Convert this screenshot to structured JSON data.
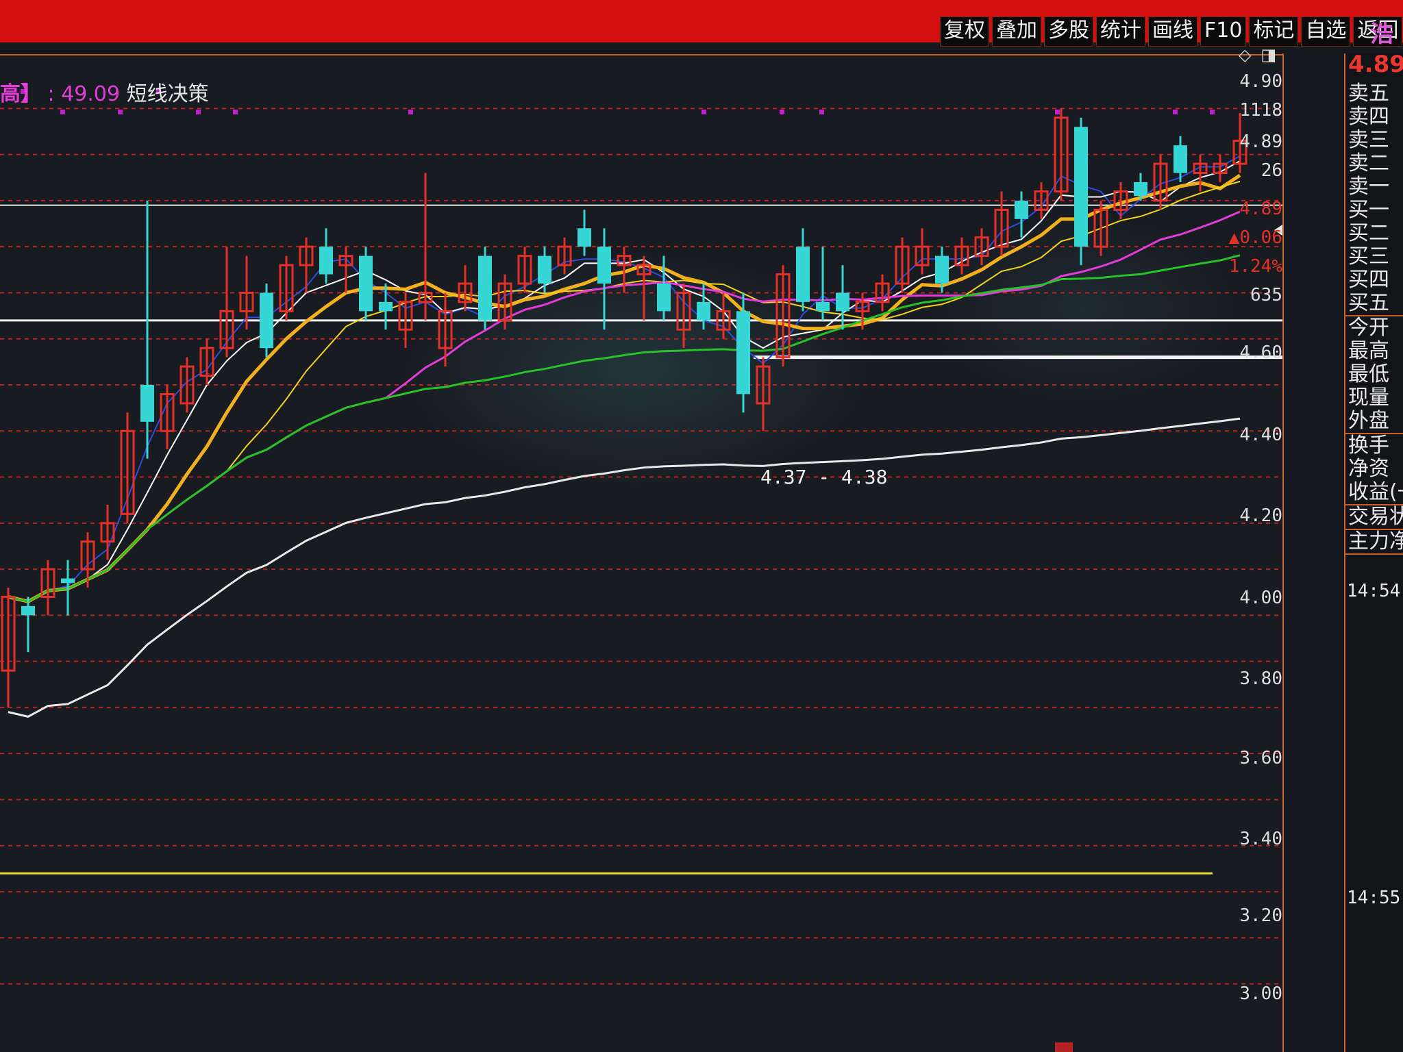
{
  "toolbar": {
    "buttons": [
      "复权",
      "叠加",
      "多股",
      "统计",
      "画线",
      "F10",
      "标记",
      "自选",
      "返回"
    ]
  },
  "stock_name": "浩",
  "indicator": {
    "name_part": "高】",
    "value": ": 49.09",
    "label": "短线决策"
  },
  "price_axis": [
    "4.90",
    "4.89",
    "4.60",
    "4.40",
    "4.20",
    "4.00",
    "3.80",
    "3.60",
    "3.40",
    "3.20",
    "3.00"
  ],
  "quote_side": {
    "ask_vol": "1118",
    "ask2_vol": "26",
    "last_price": "4.89",
    "change": "▲0.06",
    "change_pct": "1.24%",
    "bid_vol": "635"
  },
  "annotation": "4.37 - 4.38",
  "right_panel": {
    "price": "4.89",
    "order_book": [
      "卖五",
      "卖四",
      "卖三",
      "卖二",
      "卖一",
      "买一",
      "买二",
      "买三",
      "买四",
      "买五"
    ],
    "stats": [
      "今开",
      "最高",
      "最低",
      "现量",
      "外盘"
    ],
    "stats2": [
      "换手",
      "净资",
      "收益(一"
    ],
    "extra": [
      "交易状",
      "主力净"
    ],
    "time1": "14:54",
    "time2": "14:55"
  },
  "colors": {
    "up": "#e5302a",
    "down": "#34d6d6",
    "ma5": "#ffffff",
    "ma10": "#f2b01e",
    "ma20": "#e23dd8",
    "ma60": "#27c227",
    "ma120": "#e8e8e8",
    "flat": "#e8e030",
    "grid": "#b82424"
  },
  "chart_data": {
    "type": "candlestick",
    "ylim": [
      2.98,
      4.96
    ],
    "annotation_range": "4.37 - 4.38",
    "candles": [
      {
        "o": 3.68,
        "h": 3.86,
        "l": 3.6,
        "c": 3.84,
        "up": true
      },
      {
        "o": 3.8,
        "h": 3.84,
        "l": 3.72,
        "c": 3.82,
        "up": false
      },
      {
        "o": 3.84,
        "h": 3.92,
        "l": 3.8,
        "c": 3.9,
        "up": true
      },
      {
        "o": 3.88,
        "h": 3.92,
        "l": 3.8,
        "c": 3.87,
        "up": false
      },
      {
        "o": 3.9,
        "h": 3.98,
        "l": 3.86,
        "c": 3.96,
        "up": true
      },
      {
        "o": 3.96,
        "h": 4.04,
        "l": 3.92,
        "c": 4.0,
        "up": true
      },
      {
        "o": 4.02,
        "h": 4.24,
        "l": 4.0,
        "c": 4.2,
        "up": true
      },
      {
        "o": 4.22,
        "h": 4.7,
        "l": 4.14,
        "c": 4.3,
        "up": false
      },
      {
        "o": 4.2,
        "h": 4.3,
        "l": 4.16,
        "c": 4.28,
        "up": true
      },
      {
        "o": 4.26,
        "h": 4.36,
        "l": 4.24,
        "c": 4.34,
        "up": true
      },
      {
        "o": 4.32,
        "h": 4.4,
        "l": 4.3,
        "c": 4.38,
        "up": true
      },
      {
        "o": 4.38,
        "h": 4.6,
        "l": 4.36,
        "c": 4.46,
        "up": true
      },
      {
        "o": 4.46,
        "h": 4.58,
        "l": 4.42,
        "c": 4.5,
        "up": true
      },
      {
        "o": 4.5,
        "h": 4.52,
        "l": 4.36,
        "c": 4.38,
        "up": false
      },
      {
        "o": 4.46,
        "h": 4.58,
        "l": 4.44,
        "c": 4.56,
        "up": true
      },
      {
        "o": 4.56,
        "h": 4.62,
        "l": 4.5,
        "c": 4.6,
        "up": true
      },
      {
        "o": 4.6,
        "h": 4.64,
        "l": 4.52,
        "c": 4.54,
        "up": false
      },
      {
        "o": 4.56,
        "h": 4.6,
        "l": 4.5,
        "c": 4.58,
        "up": true
      },
      {
        "o": 4.58,
        "h": 4.6,
        "l": 4.44,
        "c": 4.46,
        "up": false
      },
      {
        "o": 4.48,
        "h": 4.52,
        "l": 4.42,
        "c": 4.46,
        "up": false
      },
      {
        "o": 4.42,
        "h": 4.5,
        "l": 4.38,
        "c": 4.48,
        "up": true
      },
      {
        "o": 4.48,
        "h": 4.76,
        "l": 4.44,
        "c": 4.5,
        "up": true
      },
      {
        "o": 4.46,
        "h": 4.5,
        "l": 4.34,
        "c": 4.38,
        "up": true
      },
      {
        "o": 4.48,
        "h": 4.56,
        "l": 4.46,
        "c": 4.52,
        "up": true
      },
      {
        "o": 4.58,
        "h": 4.6,
        "l": 4.42,
        "c": 4.44,
        "up": false
      },
      {
        "o": 4.44,
        "h": 4.54,
        "l": 4.42,
        "c": 4.52,
        "up": true
      },
      {
        "o": 4.52,
        "h": 4.6,
        "l": 4.5,
        "c": 4.58,
        "up": true
      },
      {
        "o": 4.58,
        "h": 4.6,
        "l": 4.5,
        "c": 4.52,
        "up": false
      },
      {
        "o": 4.56,
        "h": 4.62,
        "l": 4.54,
        "c": 4.6,
        "up": true
      },
      {
        "o": 4.64,
        "h": 4.68,
        "l": 4.58,
        "c": 4.6,
        "up": false
      },
      {
        "o": 4.6,
        "h": 4.64,
        "l": 4.42,
        "c": 4.52,
        "up": false
      },
      {
        "o": 4.56,
        "h": 4.6,
        "l": 4.5,
        "c": 4.58,
        "up": true
      },
      {
        "o": 4.54,
        "h": 4.58,
        "l": 4.44,
        "c": 4.56,
        "up": true
      },
      {
        "o": 4.52,
        "h": 4.58,
        "l": 4.44,
        "c": 4.46,
        "up": false
      },
      {
        "o": 4.5,
        "h": 4.52,
        "l": 4.38,
        "c": 4.42,
        "up": true
      },
      {
        "o": 4.48,
        "h": 4.52,
        "l": 4.42,
        "c": 4.44,
        "up": false
      },
      {
        "o": 4.46,
        "h": 4.5,
        "l": 4.4,
        "c": 4.42,
        "up": true
      },
      {
        "o": 4.46,
        "h": 4.5,
        "l": 4.24,
        "c": 4.28,
        "up": false
      },
      {
        "o": 4.26,
        "h": 4.36,
        "l": 4.2,
        "c": 4.34,
        "up": true
      },
      {
        "o": 4.36,
        "h": 4.56,
        "l": 4.34,
        "c": 4.54,
        "up": true
      },
      {
        "o": 4.6,
        "h": 4.64,
        "l": 4.46,
        "c": 4.48,
        "up": false
      },
      {
        "o": 4.48,
        "h": 4.6,
        "l": 4.44,
        "c": 4.46,
        "up": false
      },
      {
        "o": 4.5,
        "h": 4.56,
        "l": 4.42,
        "c": 4.46,
        "up": false
      },
      {
        "o": 4.46,
        "h": 4.5,
        "l": 4.42,
        "c": 4.48,
        "up": true
      },
      {
        "o": 4.48,
        "h": 4.54,
        "l": 4.46,
        "c": 4.52,
        "up": true
      },
      {
        "o": 4.52,
        "h": 4.62,
        "l": 4.5,
        "c": 4.6,
        "up": true
      },
      {
        "o": 4.56,
        "h": 4.64,
        "l": 4.54,
        "c": 4.6,
        "up": true
      },
      {
        "o": 4.58,
        "h": 4.6,
        "l": 4.5,
        "c": 4.52,
        "up": false
      },
      {
        "o": 4.56,
        "h": 4.62,
        "l": 4.54,
        "c": 4.6,
        "up": true
      },
      {
        "o": 4.58,
        "h": 4.64,
        "l": 4.56,
        "c": 4.62,
        "up": true
      },
      {
        "o": 4.6,
        "h": 4.72,
        "l": 4.58,
        "c": 4.68,
        "up": true
      },
      {
        "o": 4.7,
        "h": 4.72,
        "l": 4.62,
        "c": 4.66,
        "up": false
      },
      {
        "o": 4.68,
        "h": 4.74,
        "l": 4.66,
        "c": 4.72,
        "up": true
      },
      {
        "o": 4.72,
        "h": 4.9,
        "l": 4.7,
        "c": 4.88,
        "up": true
      },
      {
        "o": 4.86,
        "h": 4.88,
        "l": 4.56,
        "c": 4.6,
        "up": false
      },
      {
        "o": 4.6,
        "h": 4.7,
        "l": 4.58,
        "c": 4.68,
        "up": true
      },
      {
        "o": 4.68,
        "h": 4.74,
        "l": 4.66,
        "c": 4.72,
        "up": true
      },
      {
        "o": 4.74,
        "h": 4.76,
        "l": 4.7,
        "c": 4.71,
        "up": false
      },
      {
        "o": 4.7,
        "h": 4.8,
        "l": 4.68,
        "c": 4.78,
        "up": true
      },
      {
        "o": 4.82,
        "h": 4.84,
        "l": 4.74,
        "c": 4.76,
        "up": false
      },
      {
        "o": 4.76,
        "h": 4.8,
        "l": 4.72,
        "c": 4.78,
        "up": true
      },
      {
        "o": 4.76,
        "h": 4.8,
        "l": 4.74,
        "c": 4.78,
        "up": true
      },
      {
        "o": 4.78,
        "h": 4.89,
        "l": 4.76,
        "c": 4.83,
        "up": true
      }
    ]
  }
}
